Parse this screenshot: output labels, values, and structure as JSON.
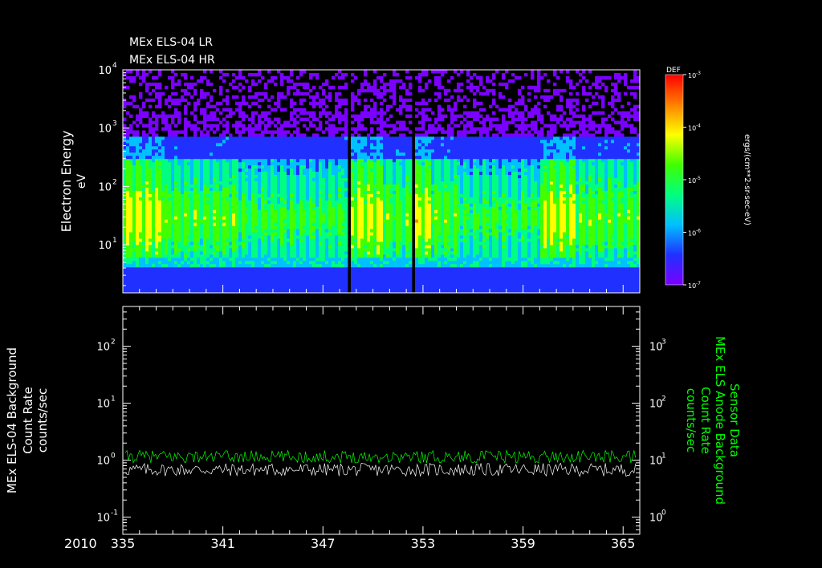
{
  "chart_data": [
    {
      "type": "heatmap",
      "title_lines": [
        "MEx ELS-04 LR",
        "MEx ELS-04 HR"
      ],
      "ylabel": "Electron Energy",
      "yunit": "eV",
      "yscale": "log",
      "ylim": [
        1.5,
        10000
      ],
      "yticks": [
        {
          "base": "10",
          "exp": "4",
          "value": 10000
        },
        {
          "base": "10",
          "exp": "3",
          "value": 1000
        },
        {
          "base": "10",
          "exp": "2",
          "value": 100
        },
        {
          "base": "10",
          "exp": "1",
          "value": 10
        }
      ],
      "xlim": [
        335,
        366
      ],
      "data_gaps_day": [
        [
          348.4,
          348.6
        ],
        [
          352.25,
          352.45
        ]
      ],
      "enhanced_intervals_day": [
        [
          335,
          337.5
        ],
        [
          348.6,
          350.5
        ],
        [
          352.5,
          353.5
        ],
        [
          360.3,
          362.2
        ]
      ],
      "low_flux_intervals_day": [
        [
          342,
          348.2
        ],
        [
          355,
          360
        ]
      ],
      "colorbar": {
        "label": "DEF",
        "unit": "ergs/(cm**2-sr-sec-eV)",
        "scale": "log",
        "ticks": [
          {
            "base": "10",
            "exp": "-3",
            "value": 0.001
          },
          {
            "base": "10",
            "exp": "-4",
            "value": 0.0001
          },
          {
            "base": "10",
            "exp": "-5",
            "value": 1e-05
          },
          {
            "base": "10",
            "exp": "-6",
            "value": 1e-06
          },
          {
            "base": "10",
            "exp": "-7",
            "value": 1e-07
          }
        ],
        "colors": [
          "#7a00ff",
          "#2030ff",
          "#00c0ff",
          "#00ff80",
          "#40ff00",
          "#ffff00",
          "#ff8000",
          "#ff0000"
        ]
      }
    },
    {
      "type": "line",
      "left_ylabel_lines": [
        "MEx ELS-04 Background",
        "Count Rate",
        "counts/sec"
      ],
      "right_ylabel_lines": [
        "Sensor Data",
        "MEx ELS Anode Background",
        "Count Rate",
        "counts/sec"
      ],
      "right_label_color": "#00ff00",
      "yscale": "log",
      "left_ylim": [
        0.05,
        500
      ],
      "left_yticks": [
        {
          "base": "10",
          "exp": "2",
          "value": 100
        },
        {
          "base": "10",
          "exp": "1",
          "value": 10
        },
        {
          "base": "10",
          "exp": "0",
          "value": 1
        },
        {
          "base": "10",
          "exp": "-1",
          "value": 0.1
        }
      ],
      "right_ylim": [
        0.5,
        5000
      ],
      "right_yticks": [
        {
          "base": "10",
          "exp": "3",
          "value": 1000
        },
        {
          "base": "10",
          "exp": "2",
          "value": 100
        },
        {
          "base": "10",
          "exp": "1",
          "value": 10
        },
        {
          "base": "10",
          "exp": "0",
          "value": 1
        }
      ],
      "xlim": [
        335,
        366
      ],
      "x_major_ticks": [
        335,
        341,
        347,
        353,
        359,
        365
      ],
      "x_tick_labels": [
        "335",
        "341",
        "347",
        "353",
        "359",
        "365"
      ],
      "year_label": "2010",
      "series": [
        {
          "color": "#ffffff",
          "axis": "left",
          "level": 0.68,
          "min": 0.5,
          "max": 0.9
        },
        {
          "color": "#00ff00",
          "axis": "right",
          "level": 11.5,
          "min": 9,
          "max": 16
        }
      ]
    }
  ]
}
